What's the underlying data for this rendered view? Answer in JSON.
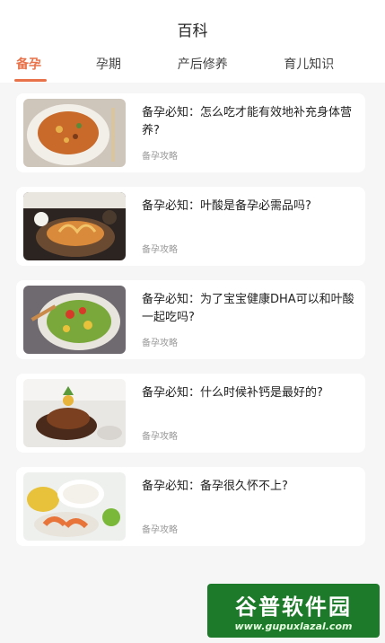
{
  "header": {
    "title": "百科"
  },
  "tabs": [
    {
      "label": "备孕",
      "active": true
    },
    {
      "label": "孕期",
      "active": false
    },
    {
      "label": "产后修养",
      "active": false
    },
    {
      "label": "育儿知识",
      "active": false
    }
  ],
  "articles": [
    {
      "title": "备孕必知：怎么吃才能有效地补充身体营养?",
      "tag": "备孕攻略",
      "image": "fried-rice-dish"
    },
    {
      "title": "备孕必知：叶酸是备孕必需品吗?",
      "tag": "备孕攻略",
      "image": "seafood-noodle-dish"
    },
    {
      "title": "备孕必知：为了宝宝健康DHA可以和叶酸一起吃吗?",
      "tag": "备孕攻略",
      "image": "vegetable-salad-dish"
    },
    {
      "title": "备孕必知：什么时候补钙是最好的?",
      "tag": "备孕攻略",
      "image": "grilled-meat-dish"
    },
    {
      "title": "备孕必知：备孕很久怀不上?",
      "tag": "备孕攻略",
      "image": "shrimp-rice-dish"
    }
  ],
  "watermark": {
    "name": "谷普软件园",
    "url": "www.gupuxlazal.com"
  },
  "colors": {
    "accent": "#e8734a",
    "background": "#f6f6f6",
    "card": "#ffffff",
    "muted": "#999999"
  }
}
